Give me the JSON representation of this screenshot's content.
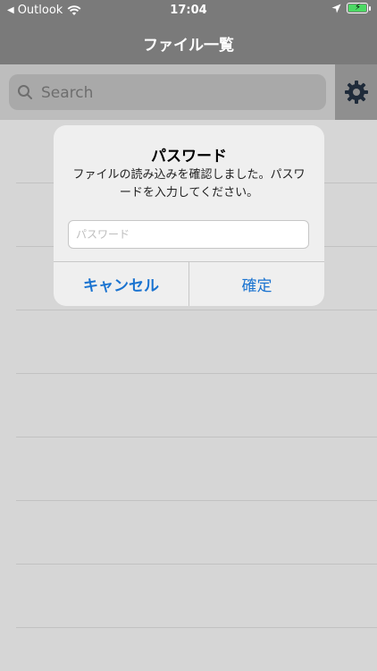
{
  "status": {
    "back_app": "Outlook",
    "time": "17:04"
  },
  "nav": {
    "title": "ファイル一覧"
  },
  "search": {
    "placeholder": "Search"
  },
  "dialog": {
    "title": "パスワード",
    "message": "ファイルの読み込みを確認しました。パスワードを入力してください。",
    "password_placeholder": "パスワード",
    "password_value": "",
    "cancel_label": "キャンセル",
    "ok_label": "確定"
  },
  "colors": {
    "accent": "#1a73d0",
    "bar": "#7a7a7a",
    "battery": "#4cd964"
  }
}
